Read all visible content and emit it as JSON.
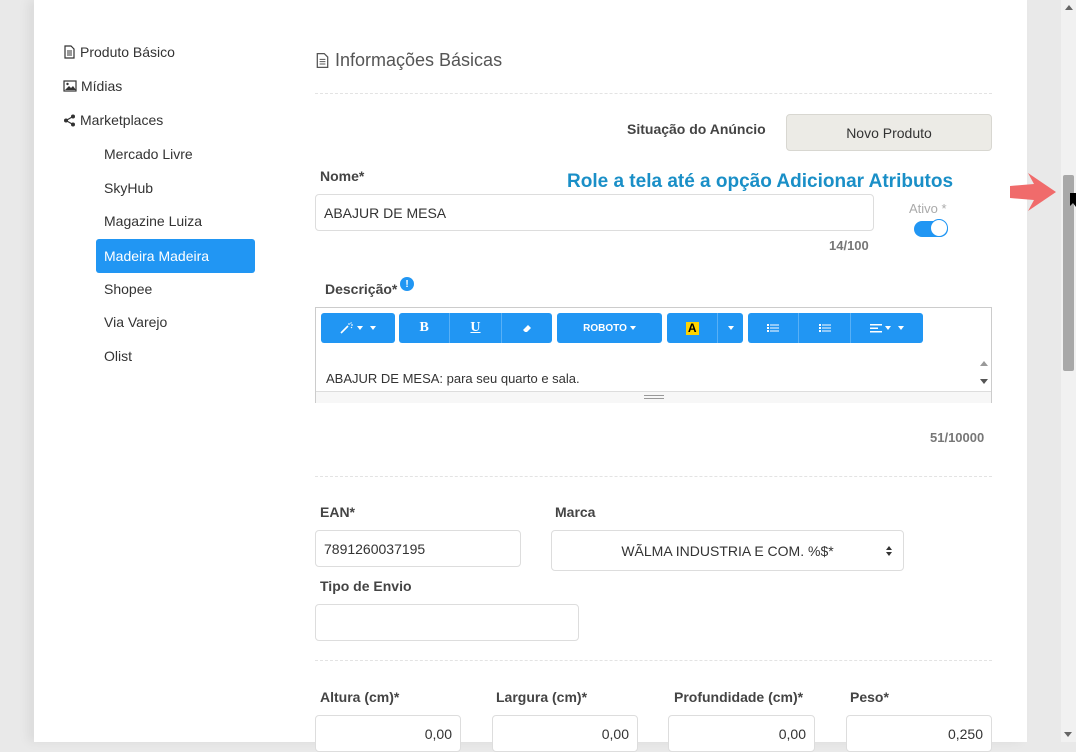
{
  "sidebar": {
    "items": [
      {
        "label": "Produto Básico",
        "icon": "document-icon"
      },
      {
        "label": "Mídias",
        "icon": "image-icon"
      },
      {
        "label": "Marketplaces",
        "icon": "share-icon"
      }
    ],
    "marketplaces": [
      "Mercado Livre",
      "SkyHub",
      "Magazine Luiza",
      "Madeira Madeira",
      "Shopee",
      "Via Varejo",
      "Olist"
    ],
    "active_marketplace": "Madeira Madeira"
  },
  "section": {
    "title": "Informações Básicas"
  },
  "situacao": {
    "label": "Situação do Anúncio",
    "value": "Novo Produto"
  },
  "annotation": {
    "text": "Role a tela até a opção Adicionar Atributos",
    "color": "#1a8fc7",
    "arrow_color": "#f06b6b"
  },
  "nome": {
    "label": "Nome*",
    "value": "ABAJUR DE MESA",
    "counter": "14/100"
  },
  "ativo": {
    "label": "Ativo *",
    "on": true
  },
  "descricao": {
    "label": "Descrição*",
    "info_icon": "!",
    "text": "ABAJUR DE MESA: para seu quarto e sala.",
    "counter": "51/10000",
    "toolbar": {
      "bold": "B",
      "underline": "U",
      "font": "ROBOTO",
      "color_letter": "A"
    }
  },
  "ean": {
    "label": "EAN*",
    "value": "7891260037195"
  },
  "marca": {
    "label": "Marca",
    "value": "WÃLMA INDUSTRIA E COM. %$*"
  },
  "tipo_envio": {
    "label": "Tipo de Envio",
    "value": ""
  },
  "dimensions": [
    {
      "label": "Altura (cm)*",
      "value": "0,00"
    },
    {
      "label": "Largura (cm)*",
      "value": "0,00"
    },
    {
      "label": "Profundidade (cm)*",
      "value": "0,00"
    },
    {
      "label": "Peso*",
      "value": "0,250"
    }
  ],
  "colors": {
    "accent": "#2196f3",
    "active_bg": "#2196f3"
  }
}
